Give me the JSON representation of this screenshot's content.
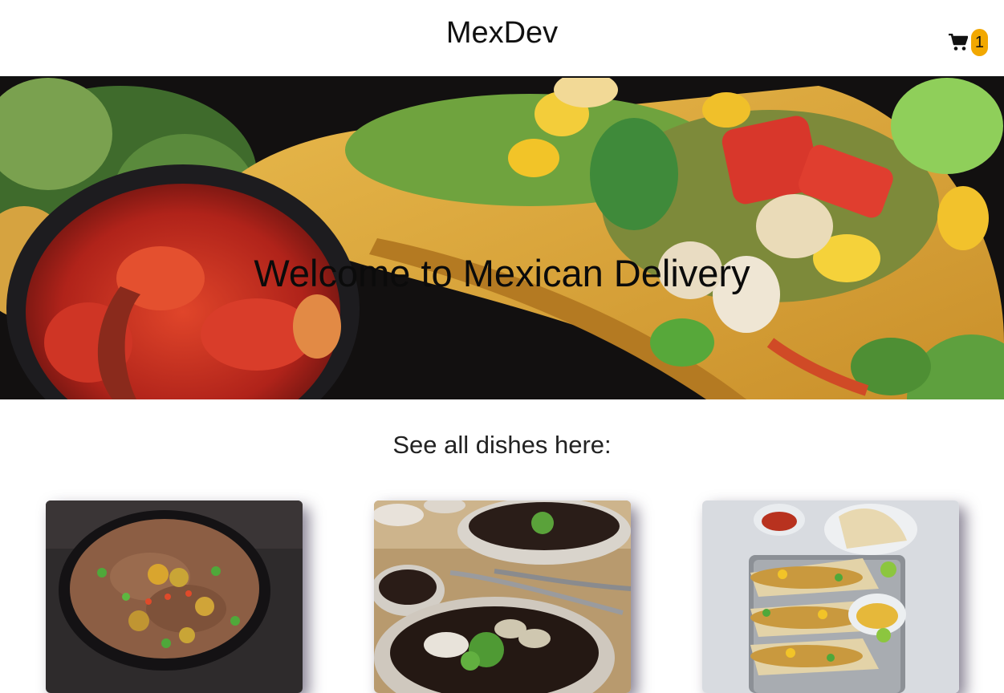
{
  "header": {
    "brand": "MexDev",
    "cart_icon": "shopping-cart-icon",
    "cart_count": "1",
    "badge_color": "#f2a800"
  },
  "hero": {
    "title": "Welcome to Mexican Delivery",
    "image": "taco-with-salsa-photo"
  },
  "dishes_section": {
    "title": "See all dishes here:",
    "cards": [
      {
        "image": "refried-beans-dish-photo"
      },
      {
        "image": "black-bean-soup-dish-photo"
      },
      {
        "image": "fish-tacos-dish-photo"
      }
    ]
  }
}
